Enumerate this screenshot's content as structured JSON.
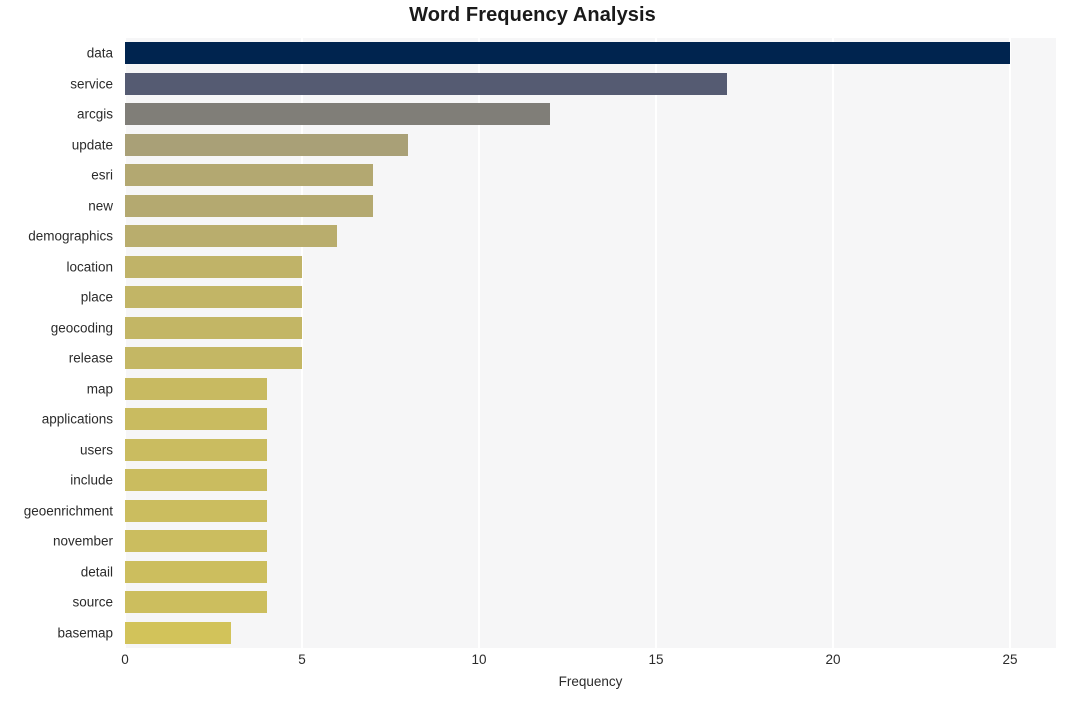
{
  "chart_data": {
    "type": "bar",
    "orientation": "horizontal",
    "title": "Word Frequency Analysis",
    "xlabel": "Frequency",
    "ylabel": "",
    "xlim": [
      0,
      26.3
    ],
    "xticks": [
      0,
      5,
      10,
      15,
      20,
      25
    ],
    "xtick_labels": [
      "0",
      "5",
      "10",
      "15",
      "20",
      "25"
    ],
    "grid": "vertical-white-on-light-gray",
    "legend": "none",
    "categories": [
      "data",
      "service",
      "arcgis",
      "update",
      "esri",
      "new",
      "demographics",
      "location",
      "place",
      "geocoding",
      "release",
      "map",
      "applications",
      "users",
      "include",
      "geoenrichment",
      "november",
      "detail",
      "source",
      "basemap"
    ],
    "values": [
      25,
      17,
      12,
      8,
      7,
      7,
      6,
      5,
      5,
      5,
      5,
      4,
      4,
      4,
      4,
      4,
      4,
      4,
      4,
      3
    ],
    "bar_colors": [
      "#00244f",
      "#555b72",
      "#807e78",
      "#a9a077",
      "#b3a871",
      "#b4a970",
      "#b9ad6d",
      "#c0b368",
      "#c2b566",
      "#c3b665",
      "#c4b764",
      "#c8ba61",
      "#c9bb60",
      "#cabc60",
      "#cabc5f",
      "#cbbd5f",
      "#cbbd5f",
      "#ccbe5e",
      "#ccbe5e",
      "#d2c35a"
    ],
    "plot_background": "#f6f6f7",
    "gridline_color": "#ffffff",
    "title_color": "#1a1a1a",
    "tick_color": "#2b2b2b"
  }
}
